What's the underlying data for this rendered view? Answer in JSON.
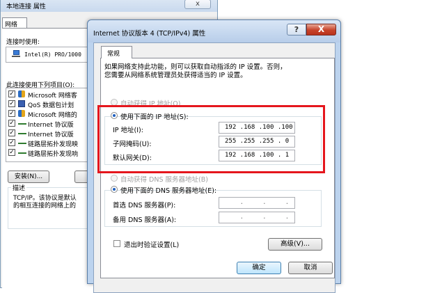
{
  "back_window": {
    "title": "本地连接 属性",
    "close_glyph": "x",
    "tab": "网络",
    "connect_using_label": "连接时使用:",
    "adapter_name": "Intel(R) PRO/1000",
    "items_label": "此连接使用下列项目(O):",
    "items": [
      {
        "label": "Microsoft 网络客",
        "checked": true,
        "icon": "network-client-icon"
      },
      {
        "label": "QoS 数据包计划",
        "checked": true,
        "icon": "qos-icon"
      },
      {
        "label": "Microsoft 网络的",
        "checked": true,
        "icon": "network-client-icon"
      },
      {
        "label": "Internet 协议版",
        "checked": true,
        "icon": "protocol-icon"
      },
      {
        "label": "Internet 协议版",
        "checked": true,
        "icon": "protocol-icon"
      },
      {
        "label": "链路层拓扑发现映",
        "checked": true,
        "icon": "protocol-icon"
      },
      {
        "label": "链路层拓扑发现响",
        "checked": true,
        "icon": "protocol-icon"
      }
    ],
    "install_button": "安装(N)...",
    "description_label": "描述",
    "description_line1": "TCP/IP。该协议是默认",
    "description_line2": "的相互连接的网络上的"
  },
  "dialog": {
    "title": "Internet 协议版本 4 (TCP/IPv4) 属性",
    "help_glyph": "?",
    "close_glyph": "X",
    "tab": "常规",
    "intro_line1": "如果网络支持此功能，则可以获取自动指派的 IP 设置。否则，",
    "intro_line2": "您需要从网络系统管理员处获得适当的 IP 设置。",
    "auto_ip_label": "自动获得 IP 地址(O)",
    "manual_ip_label": "使用下面的 IP 地址(S):",
    "ip_label": "IP 地址(I):",
    "ip_value": "192 .168 .100 .100",
    "mask_label": "子网掩码(U):",
    "mask_value": "255 .255 .255 . 0",
    "gateway_label": "默认网关(D):",
    "gateway_value": "192 .168 .100 . 1",
    "auto_dns_label": "自动获得 DNS 服务器地址(B)",
    "manual_dns_label": "使用下面的 DNS 服务器地址(E):",
    "preferred_dns_label": "首选 DNS 服务器(P):",
    "preferred_dns_value": "    .     .     .    ",
    "alternate_dns_label": "备用 DNS 服务器(A):",
    "alternate_dns_value": "    .     .     .    ",
    "validate_on_exit_label": "退出时验证设置(L)",
    "advanced_button": "高级(V)...",
    "ok_button": "确定",
    "cancel_button": "取消"
  },
  "colors": {
    "highlight_box": "#e5161d",
    "dialog_frame": "#bcd3ee",
    "close_button": "#c7432a"
  }
}
